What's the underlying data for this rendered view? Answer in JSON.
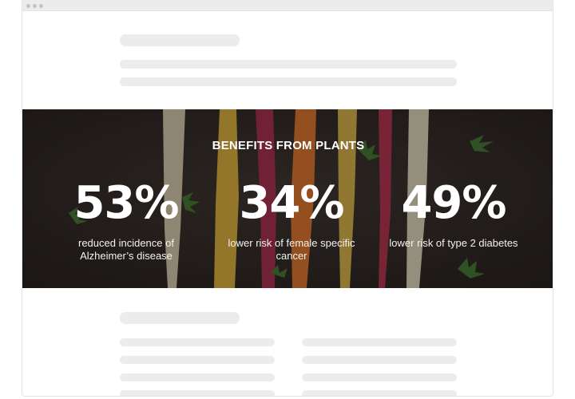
{
  "colors": {
    "banner_overlay": "#14100e",
    "skeleton": "#ececec",
    "text": "#ffffff"
  },
  "banner": {
    "title": "BENEFITS FROM PLANTS",
    "stats": [
      {
        "value": "53%",
        "description": "reduced incidence of Alzheimer’s disease"
      },
      {
        "value": "34%",
        "description": "lower risk of female specific cancer"
      },
      {
        "value": "49%",
        "description": "lower risk of type 2 diabetes"
      }
    ],
    "background_image": "carrots-on-dark-surface"
  }
}
